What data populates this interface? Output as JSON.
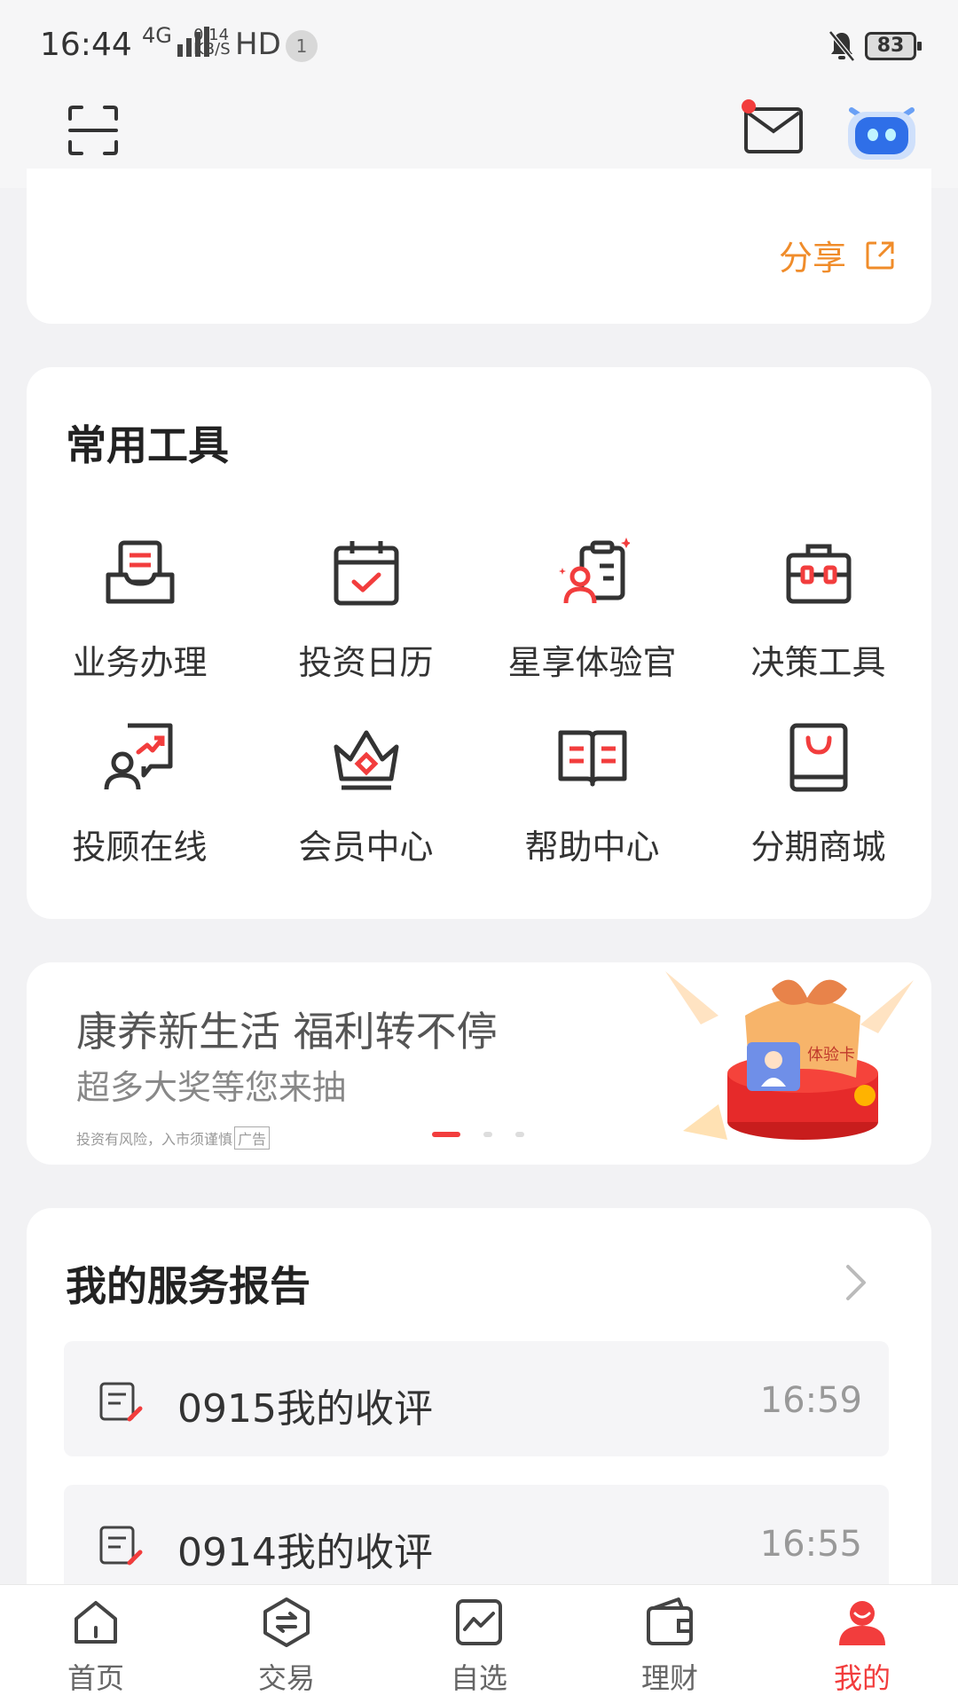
{
  "status_bar": {
    "time": "16:44",
    "network": "4G",
    "speed_top": "0.14",
    "speed_bottom": "KB/S",
    "hd": "HD",
    "notification_count": "1",
    "battery": "83"
  },
  "share": {
    "label": "分享"
  },
  "tools": {
    "title": "常用工具",
    "items": [
      {
        "label": "业务办理",
        "icon": "business-icon"
      },
      {
        "label": "投资日历",
        "icon": "calendar-icon"
      },
      {
        "label": "星享体验官",
        "icon": "experience-officer-icon"
      },
      {
        "label": "决策工具",
        "icon": "toolbox-icon"
      },
      {
        "label": "投顾在线",
        "icon": "advisor-icon"
      },
      {
        "label": "会员中心",
        "icon": "crown-icon"
      },
      {
        "label": "帮助中心",
        "icon": "book-icon"
      },
      {
        "label": "分期商城",
        "icon": "shopping-bag-icon"
      }
    ]
  },
  "banner": {
    "title": "康养新生活 福利转不停",
    "subtitle": "超多大奖等您来抽",
    "note": "投资有风险，入市须谨慎",
    "ad_tag": "广告",
    "card_text": "体验卡"
  },
  "reports": {
    "title": "我的服务报告",
    "items": [
      {
        "title": "0915我的收评",
        "time": "16:59"
      },
      {
        "title": "0914我的收评",
        "time": "16:55"
      }
    ]
  },
  "bottom_nav": {
    "items": [
      {
        "label": "首页",
        "icon": "home-icon"
      },
      {
        "label": "交易",
        "icon": "trade-icon"
      },
      {
        "label": "自选",
        "icon": "watchlist-icon"
      },
      {
        "label": "理财",
        "icon": "wallet-icon"
      },
      {
        "label": "我的",
        "icon": "profile-icon",
        "active": true
      }
    ]
  },
  "colors": {
    "accent": "#f23d3d",
    "share": "#f08c2a"
  }
}
